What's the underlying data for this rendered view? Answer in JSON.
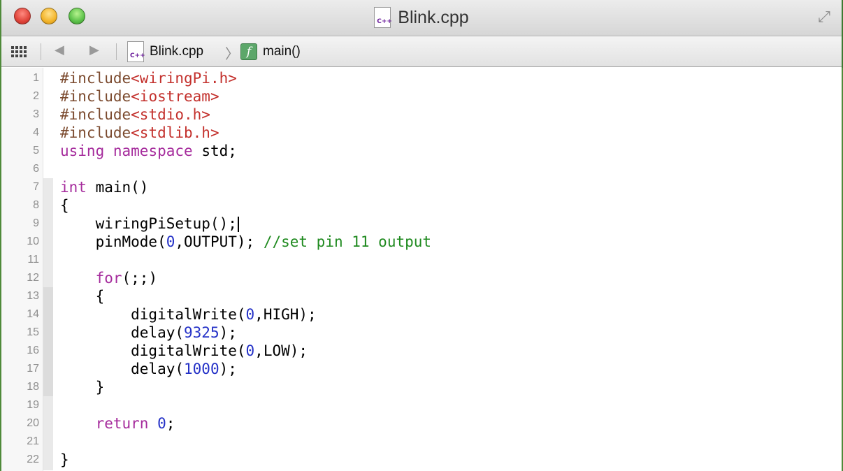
{
  "window": {
    "title": "Blink.cpp",
    "file_icon_label": "C++"
  },
  "jumpbar": {
    "back_arrow": "◀",
    "forward_arrow": "▶",
    "file_crumb": "Blink.cpp",
    "separator": "〉",
    "function_icon_glyph": "f",
    "function_crumb": "main()"
  },
  "editor": {
    "cursor_line": 9,
    "lines": [
      {
        "n": "1",
        "tokens": [
          {
            "t": "#include",
            "c": "pp"
          },
          {
            "t": "<wiringPi.h>",
            "c": "str"
          }
        ]
      },
      {
        "n": "2",
        "tokens": [
          {
            "t": "#include",
            "c": "pp"
          },
          {
            "t": "<iostream>",
            "c": "str"
          }
        ]
      },
      {
        "n": "3",
        "tokens": [
          {
            "t": "#include",
            "c": "pp"
          },
          {
            "t": "<stdio.h>",
            "c": "str"
          }
        ]
      },
      {
        "n": "4",
        "tokens": [
          {
            "t": "#include",
            "c": "pp"
          },
          {
            "t": "<stdlib.h>",
            "c": "str"
          }
        ]
      },
      {
        "n": "5",
        "tokens": [
          {
            "t": "using",
            "c": "kw"
          },
          {
            "t": " "
          },
          {
            "t": "namespace",
            "c": "kw"
          },
          {
            "t": " std;"
          }
        ]
      },
      {
        "n": "6",
        "tokens": []
      },
      {
        "n": "7",
        "tokens": [
          {
            "t": "int",
            "c": "kw"
          },
          {
            "t": " main()"
          }
        ]
      },
      {
        "n": "8",
        "tokens": [
          {
            "t": "{"
          }
        ]
      },
      {
        "n": "9",
        "tokens": [
          {
            "t": "    wiringPiSetup();"
          }
        ]
      },
      {
        "n": "10",
        "tokens": [
          {
            "t": "    pinMode("
          },
          {
            "t": "0",
            "c": "num"
          },
          {
            "t": ",OUTPUT); "
          },
          {
            "t": "//set pin 11 output",
            "c": "cm"
          }
        ]
      },
      {
        "n": "11",
        "tokens": []
      },
      {
        "n": "12",
        "tokens": [
          {
            "t": "    "
          },
          {
            "t": "for",
            "c": "kw"
          },
          {
            "t": "(;;)"
          }
        ]
      },
      {
        "n": "13",
        "tokens": [
          {
            "t": "    {"
          }
        ]
      },
      {
        "n": "14",
        "tokens": [
          {
            "t": "        digitalWrite("
          },
          {
            "t": "0",
            "c": "num"
          },
          {
            "t": ",HIGH);"
          }
        ]
      },
      {
        "n": "15",
        "tokens": [
          {
            "t": "        delay("
          },
          {
            "t": "9325",
            "c": "num"
          },
          {
            "t": ");"
          }
        ]
      },
      {
        "n": "16",
        "tokens": [
          {
            "t": "        digitalWrite("
          },
          {
            "t": "0",
            "c": "num"
          },
          {
            "t": ",LOW);"
          }
        ]
      },
      {
        "n": "17",
        "tokens": [
          {
            "t": "        delay("
          },
          {
            "t": "1000",
            "c": "num"
          },
          {
            "t": ");"
          }
        ]
      },
      {
        "n": "18",
        "tokens": [
          {
            "t": "    }"
          }
        ]
      },
      {
        "n": "19",
        "tokens": []
      },
      {
        "n": "20",
        "tokens": [
          {
            "t": "    "
          },
          {
            "t": "return",
            "c": "kw"
          },
          {
            "t": " "
          },
          {
            "t": "0",
            "c": "num"
          },
          {
            "t": ";"
          }
        ]
      },
      {
        "n": "21",
        "tokens": []
      },
      {
        "n": "22",
        "tokens": [
          {
            "t": "}"
          }
        ]
      }
    ]
  },
  "colors": {
    "keyword": "#a52b9c",
    "preprocessor": "#7b4a2e",
    "string": "#c3302c",
    "number": "#2431c7",
    "comment": "#1f8a1f"
  }
}
